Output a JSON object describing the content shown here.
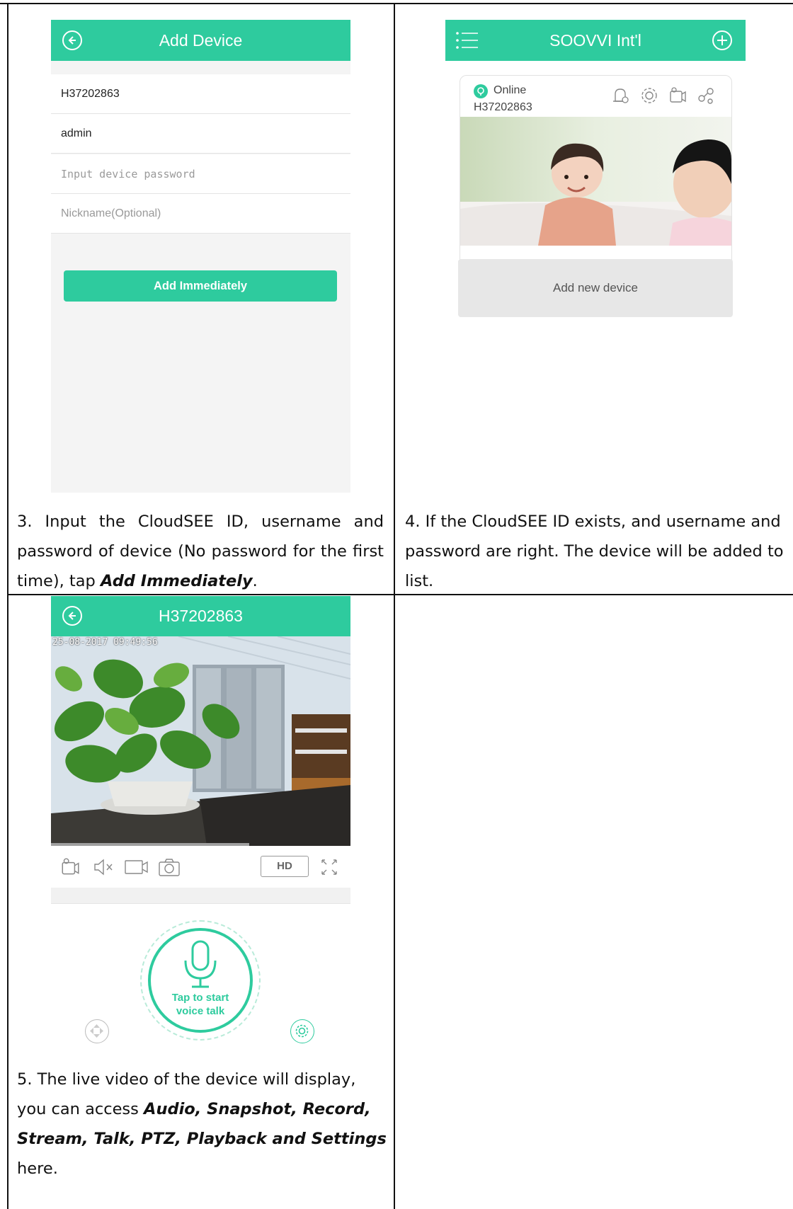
{
  "screen1": {
    "title": "Add Device",
    "fields": {
      "device_id": "H37202863",
      "username": "admin",
      "password_placeholder": "Input device password",
      "nickname_placeholder": "Nickname(Optional)"
    },
    "add_button": "Add Immediately"
  },
  "screen2": {
    "title": "SOOVVI Int'l",
    "status": "Online",
    "device_id": "H37202863",
    "add_new": "Add new device"
  },
  "screen3": {
    "title": "H37202863",
    "timestamp": "25-08-2017 09:49:56",
    "hd_label": "HD",
    "talk_label_line1": "Tap to start",
    "talk_label_line2": "voice talk"
  },
  "steps": {
    "step3_prefix": "3. Input the CloudSEE ID, username and password of device (No password for the first time), tap ",
    "step3_bold": "Add Immediately",
    "step3_suffix": ".",
    "step4": "4. If the CloudSEE ID exists, and username and password are right. The device will be added to list.",
    "step5_prefix": "5. The live video of the device will display, you can access ",
    "step5_bold": "Audio, Snapshot, Record, Stream, Talk, PTZ, Playback and Settings",
    "step5_suffix": " here."
  },
  "colors": {
    "accent": "#2ecb9e",
    "background": "#f4f4f4"
  }
}
